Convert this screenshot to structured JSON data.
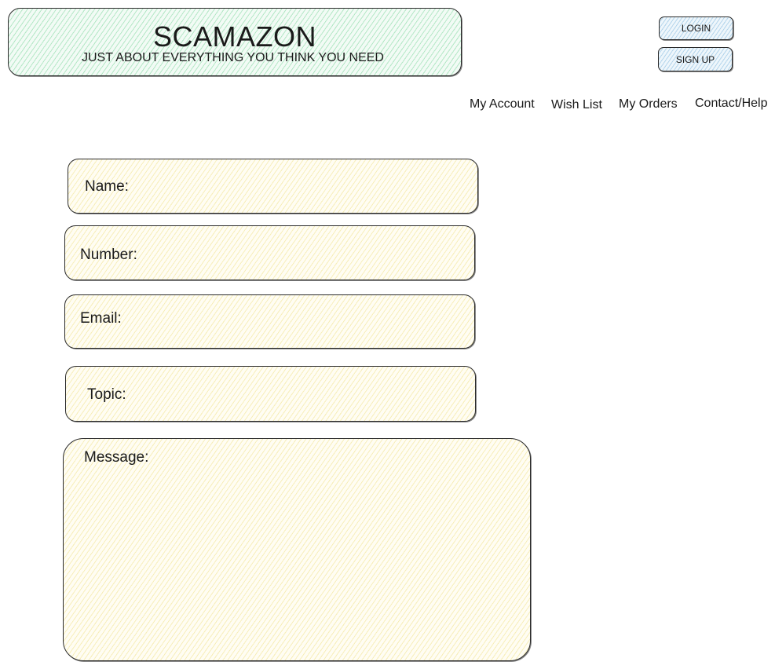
{
  "brand": {
    "title": "SCAMAZON",
    "tagline": "JUST ABOUT EVERYTHING YOU THINK YOU NEED"
  },
  "auth": {
    "login_label": "LOGIN",
    "signup_label": "SIGN UP"
  },
  "nav": {
    "items": [
      {
        "label": "My Account"
      },
      {
        "label": "Wish List"
      },
      {
        "label": "My Orders"
      },
      {
        "label": "Contact/Help"
      }
    ]
  },
  "form": {
    "name_label": "Name:",
    "number_label": "Number:",
    "email_label": "Email:",
    "topic_label": "Topic:",
    "message_label": "Message:"
  },
  "colors": {
    "brand_fill": "#f2fbf5",
    "button_fill": "#eef6fb",
    "field_fill": "#fffdf3",
    "stroke": "#2a2a2a"
  }
}
